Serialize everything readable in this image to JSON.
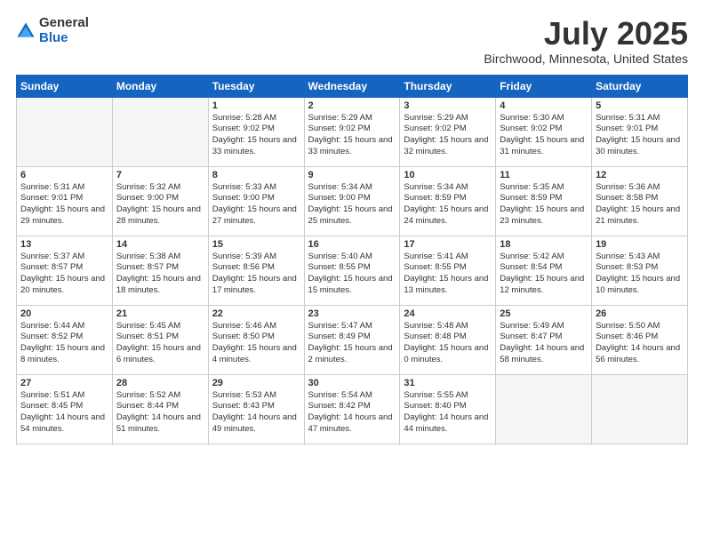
{
  "logo": {
    "general": "General",
    "blue": "Blue"
  },
  "title": "July 2025",
  "location": "Birchwood, Minnesota, United States",
  "days_of_week": [
    "Sunday",
    "Monday",
    "Tuesday",
    "Wednesday",
    "Thursday",
    "Friday",
    "Saturday"
  ],
  "weeks": [
    [
      {
        "day": "",
        "sunrise": "",
        "sunset": "",
        "daylight": ""
      },
      {
        "day": "",
        "sunrise": "",
        "sunset": "",
        "daylight": ""
      },
      {
        "day": "1",
        "sunrise": "Sunrise: 5:28 AM",
        "sunset": "Sunset: 9:02 PM",
        "daylight": "Daylight: 15 hours and 33 minutes."
      },
      {
        "day": "2",
        "sunrise": "Sunrise: 5:29 AM",
        "sunset": "Sunset: 9:02 PM",
        "daylight": "Daylight: 15 hours and 33 minutes."
      },
      {
        "day": "3",
        "sunrise": "Sunrise: 5:29 AM",
        "sunset": "Sunset: 9:02 PM",
        "daylight": "Daylight: 15 hours and 32 minutes."
      },
      {
        "day": "4",
        "sunrise": "Sunrise: 5:30 AM",
        "sunset": "Sunset: 9:02 PM",
        "daylight": "Daylight: 15 hours and 31 minutes."
      },
      {
        "day": "5",
        "sunrise": "Sunrise: 5:31 AM",
        "sunset": "Sunset: 9:01 PM",
        "daylight": "Daylight: 15 hours and 30 minutes."
      }
    ],
    [
      {
        "day": "6",
        "sunrise": "Sunrise: 5:31 AM",
        "sunset": "Sunset: 9:01 PM",
        "daylight": "Daylight: 15 hours and 29 minutes."
      },
      {
        "day": "7",
        "sunrise": "Sunrise: 5:32 AM",
        "sunset": "Sunset: 9:00 PM",
        "daylight": "Daylight: 15 hours and 28 minutes."
      },
      {
        "day": "8",
        "sunrise": "Sunrise: 5:33 AM",
        "sunset": "Sunset: 9:00 PM",
        "daylight": "Daylight: 15 hours and 27 minutes."
      },
      {
        "day": "9",
        "sunrise": "Sunrise: 5:34 AM",
        "sunset": "Sunset: 9:00 PM",
        "daylight": "Daylight: 15 hours and 25 minutes."
      },
      {
        "day": "10",
        "sunrise": "Sunrise: 5:34 AM",
        "sunset": "Sunset: 8:59 PM",
        "daylight": "Daylight: 15 hours and 24 minutes."
      },
      {
        "day": "11",
        "sunrise": "Sunrise: 5:35 AM",
        "sunset": "Sunset: 8:59 PM",
        "daylight": "Daylight: 15 hours and 23 minutes."
      },
      {
        "day": "12",
        "sunrise": "Sunrise: 5:36 AM",
        "sunset": "Sunset: 8:58 PM",
        "daylight": "Daylight: 15 hours and 21 minutes."
      }
    ],
    [
      {
        "day": "13",
        "sunrise": "Sunrise: 5:37 AM",
        "sunset": "Sunset: 8:57 PM",
        "daylight": "Daylight: 15 hours and 20 minutes."
      },
      {
        "day": "14",
        "sunrise": "Sunrise: 5:38 AM",
        "sunset": "Sunset: 8:57 PM",
        "daylight": "Daylight: 15 hours and 18 minutes."
      },
      {
        "day": "15",
        "sunrise": "Sunrise: 5:39 AM",
        "sunset": "Sunset: 8:56 PM",
        "daylight": "Daylight: 15 hours and 17 minutes."
      },
      {
        "day": "16",
        "sunrise": "Sunrise: 5:40 AM",
        "sunset": "Sunset: 8:55 PM",
        "daylight": "Daylight: 15 hours and 15 minutes."
      },
      {
        "day": "17",
        "sunrise": "Sunrise: 5:41 AM",
        "sunset": "Sunset: 8:55 PM",
        "daylight": "Daylight: 15 hours and 13 minutes."
      },
      {
        "day": "18",
        "sunrise": "Sunrise: 5:42 AM",
        "sunset": "Sunset: 8:54 PM",
        "daylight": "Daylight: 15 hours and 12 minutes."
      },
      {
        "day": "19",
        "sunrise": "Sunrise: 5:43 AM",
        "sunset": "Sunset: 8:53 PM",
        "daylight": "Daylight: 15 hours and 10 minutes."
      }
    ],
    [
      {
        "day": "20",
        "sunrise": "Sunrise: 5:44 AM",
        "sunset": "Sunset: 8:52 PM",
        "daylight": "Daylight: 15 hours and 8 minutes."
      },
      {
        "day": "21",
        "sunrise": "Sunrise: 5:45 AM",
        "sunset": "Sunset: 8:51 PM",
        "daylight": "Daylight: 15 hours and 6 minutes."
      },
      {
        "day": "22",
        "sunrise": "Sunrise: 5:46 AM",
        "sunset": "Sunset: 8:50 PM",
        "daylight": "Daylight: 15 hours and 4 minutes."
      },
      {
        "day": "23",
        "sunrise": "Sunrise: 5:47 AM",
        "sunset": "Sunset: 8:49 PM",
        "daylight": "Daylight: 15 hours and 2 minutes."
      },
      {
        "day": "24",
        "sunrise": "Sunrise: 5:48 AM",
        "sunset": "Sunset: 8:48 PM",
        "daylight": "Daylight: 15 hours and 0 minutes."
      },
      {
        "day": "25",
        "sunrise": "Sunrise: 5:49 AM",
        "sunset": "Sunset: 8:47 PM",
        "daylight": "Daylight: 14 hours and 58 minutes."
      },
      {
        "day": "26",
        "sunrise": "Sunrise: 5:50 AM",
        "sunset": "Sunset: 8:46 PM",
        "daylight": "Daylight: 14 hours and 56 minutes."
      }
    ],
    [
      {
        "day": "27",
        "sunrise": "Sunrise: 5:51 AM",
        "sunset": "Sunset: 8:45 PM",
        "daylight": "Daylight: 14 hours and 54 minutes."
      },
      {
        "day": "28",
        "sunrise": "Sunrise: 5:52 AM",
        "sunset": "Sunset: 8:44 PM",
        "daylight": "Daylight: 14 hours and 51 minutes."
      },
      {
        "day": "29",
        "sunrise": "Sunrise: 5:53 AM",
        "sunset": "Sunset: 8:43 PM",
        "daylight": "Daylight: 14 hours and 49 minutes."
      },
      {
        "day": "30",
        "sunrise": "Sunrise: 5:54 AM",
        "sunset": "Sunset: 8:42 PM",
        "daylight": "Daylight: 14 hours and 47 minutes."
      },
      {
        "day": "31",
        "sunrise": "Sunrise: 5:55 AM",
        "sunset": "Sunset: 8:40 PM",
        "daylight": "Daylight: 14 hours and 44 minutes."
      },
      {
        "day": "",
        "sunrise": "",
        "sunset": "",
        "daylight": ""
      },
      {
        "day": "",
        "sunrise": "",
        "sunset": "",
        "daylight": ""
      }
    ]
  ]
}
